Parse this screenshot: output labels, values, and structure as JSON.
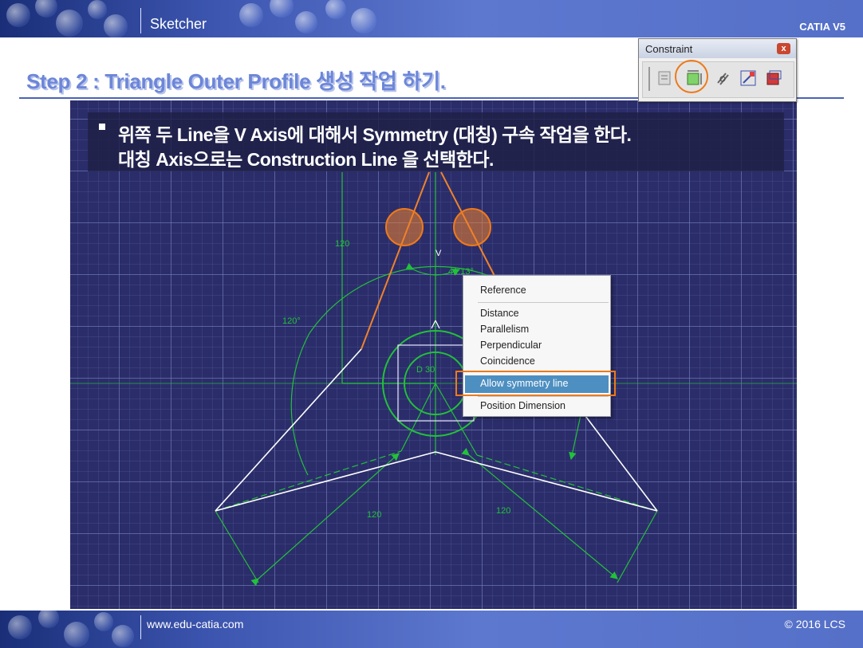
{
  "header": {
    "title": "Sketcher",
    "brand": "CATIA V5"
  },
  "step_title": "Step 2 : Triangle Outer Profile 생성 작업 하기.",
  "instructions": [
    "위쪽 두 Line을 V Axis에 대해서 Symmetry (대칭) 구속 작업을 한다.",
    "대칭 Axis으로는 Construction Line 을 선택한다."
  ],
  "toolbar": {
    "title": "Constraint",
    "close_label": "x",
    "icons": [
      "constraint-dialog-icon",
      "constraint-icon",
      "anchor-contact-constraint-icon",
      "fix-together-icon",
      "auto-constraint-icon"
    ]
  },
  "context_menu": {
    "items": [
      {
        "label": "Reference"
      },
      {
        "label": "Distance"
      },
      {
        "label": "Parallelism"
      },
      {
        "label": "Perpendicular"
      },
      {
        "label": "Coincidence"
      },
      {
        "label": "Allow symmetry line",
        "highlighted": true
      },
      {
        "label": "Position Dimension"
      }
    ]
  },
  "sketch": {
    "dimensions": {
      "dim_top_left": "120",
      "dim_bottom_left": "120",
      "dim_bottom_right": "120",
      "angle_top": "41.13°",
      "angle_left": "120°",
      "diameter": "D 30",
      "axis_label": "V"
    },
    "colors": {
      "background": "#2b2d6a",
      "construction": "#22c13a",
      "profile": "#ffffff",
      "selected": "#f0822a",
      "highlight": "#ee7a1a"
    }
  },
  "footer": {
    "url": "www.edu-catia.com",
    "copyright": "© 2016 LCS"
  }
}
